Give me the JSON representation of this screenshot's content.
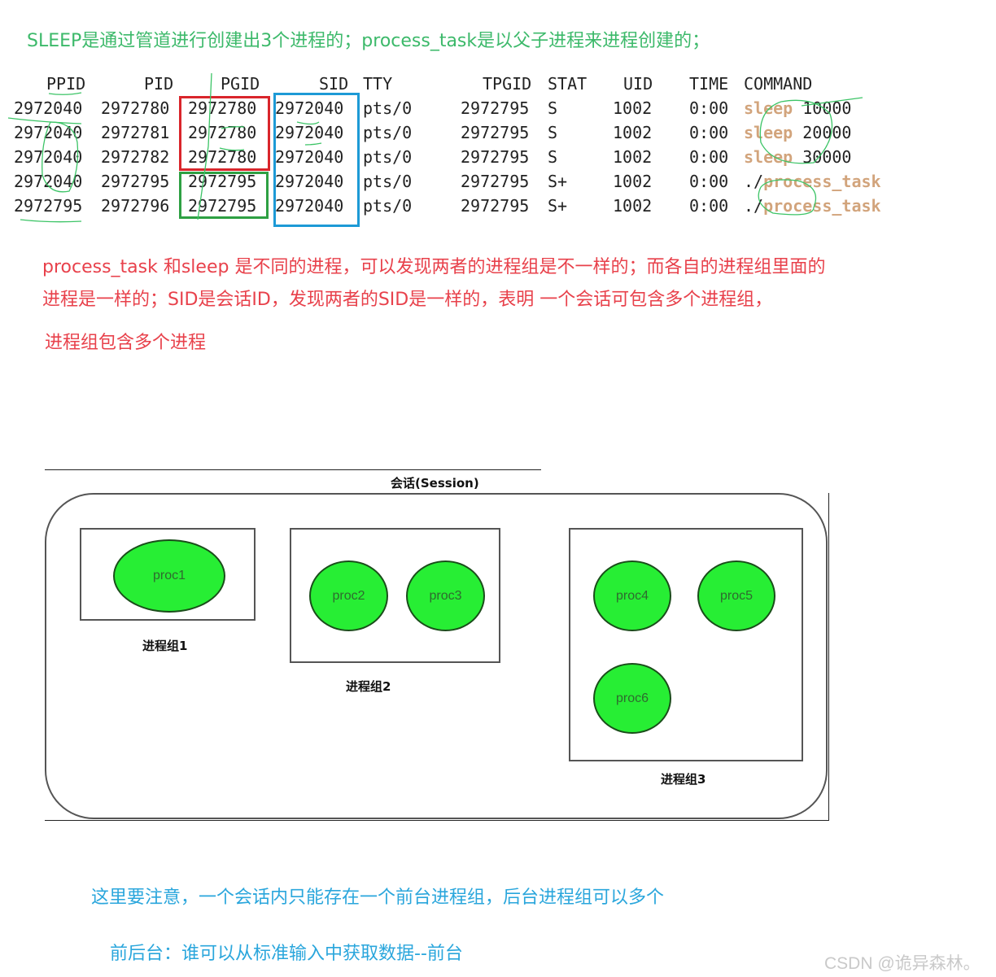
{
  "notes": {
    "top_green": "SLEEP是通过管道进行创建出3个进程的；process_task是以父子进程来进程创建的；",
    "red_line1": "process_task 和sleep 是不同的进程，可以发现两者的进程组是不一样的；而各自的进程组里面的",
    "red_line2": "进程是一样的；SID是会话ID，发现两者的SID是一样的，表明   一个会话可包含多个进程组，",
    "red_line3": "进程组包含多个进程",
    "blue_line1": "这里要注意，一个会话内只能存在一个前台进程组，后台进程组可以多个",
    "blue_line2": "前后台：谁可以从标准输入中获取数据--前台"
  },
  "ps_table": {
    "headers": [
      "PPID",
      "PID",
      "PGID",
      "SID",
      "TTY",
      "TPGID",
      "STAT",
      "UID",
      "TIME",
      "COMMAND"
    ],
    "rows": [
      {
        "ppid": "2972040",
        "pid": "2972780",
        "pgid": "2972780",
        "sid": "2972040",
        "tty": "pts/0",
        "tpgid": "2972795",
        "stat": "S",
        "uid": "1002",
        "time": "0:00",
        "cmd_prefix": "",
        "cmd_name": "sleep",
        "cmd_arg": " 10000"
      },
      {
        "ppid": "2972040",
        "pid": "2972781",
        "pgid": "2972780",
        "sid": "2972040",
        "tty": "pts/0",
        "tpgid": "2972795",
        "stat": "S",
        "uid": "1002",
        "time": "0:00",
        "cmd_prefix": "",
        "cmd_name": "sleep",
        "cmd_arg": " 20000"
      },
      {
        "ppid": "2972040",
        "pid": "2972782",
        "pgid": "2972780",
        "sid": "2972040",
        "tty": "pts/0",
        "tpgid": "2972795",
        "stat": "S",
        "uid": "1002",
        "time": "0:00",
        "cmd_prefix": "",
        "cmd_name": "sleep",
        "cmd_arg": " 30000"
      },
      {
        "ppid": "2972040",
        "pid": "2972795",
        "pgid": "2972795",
        "sid": "2972040",
        "tty": "pts/0",
        "tpgid": "2972795",
        "stat": "S+",
        "uid": "1002",
        "time": "0:00",
        "cmd_prefix": "./",
        "cmd_name": "process_task",
        "cmd_arg": ""
      },
      {
        "ppid": "2972795",
        "pid": "2972796",
        "pgid": "2972795",
        "sid": "2972040",
        "tty": "pts/0",
        "tpgid": "2972795",
        "stat": "S+",
        "uid": "1002",
        "time": "0:00",
        "cmd_prefix": "./",
        "cmd_name": "process_task",
        "cmd_arg": ""
      }
    ],
    "highlight_colors": {
      "pgid_sleep": "#d9252b",
      "pgid_task": "#2ea043",
      "sid": "#1d9ad6",
      "command": "#d2a47c"
    }
  },
  "diagram": {
    "session_title": "会话(Session)",
    "groups": [
      {
        "label": "进程组1",
        "procs": [
          "proc1"
        ]
      },
      {
        "label": "进程组2",
        "procs": [
          "proc2",
          "proc3"
        ]
      },
      {
        "label": "进程组3",
        "procs": [
          "proc4",
          "proc5",
          "proc6"
        ]
      }
    ],
    "proc_color": "#27ee34"
  },
  "watermark": "CSDN @诡异森林。"
}
